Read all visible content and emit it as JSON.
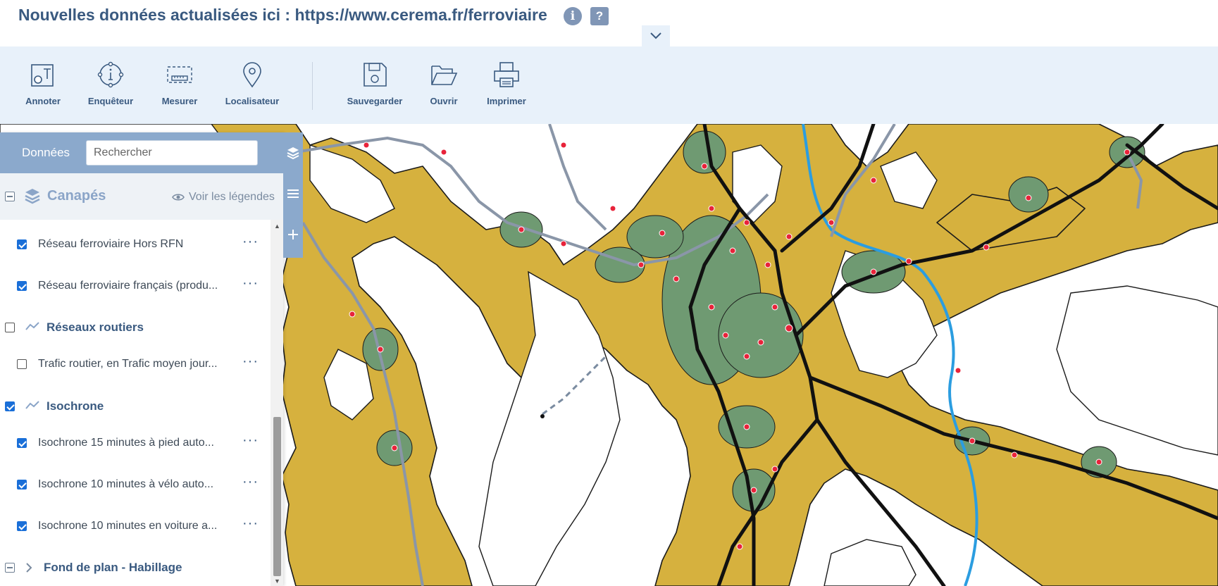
{
  "header": {
    "title": "Nouvelles données actualisées ici : https://www.cerema.fr/ferroviaire",
    "info_icon": "i",
    "help_icon": "?",
    "collapse_icon": "chevron-down-icon"
  },
  "toolbar": {
    "tools": [
      {
        "label": "Annoter",
        "icon": "annotate-icon"
      },
      {
        "label": "Enquêteur",
        "icon": "info-circle-icon"
      },
      {
        "label": "Mesurer",
        "icon": "ruler-icon"
      },
      {
        "label": "Localisateur",
        "icon": "map-pin-icon"
      },
      {
        "label": "Sauvegarder",
        "icon": "floppy-disk-icon"
      },
      {
        "label": "Ouvrir",
        "icon": "folder-open-icon"
      },
      {
        "label": "Imprimer",
        "icon": "printer-icon"
      }
    ]
  },
  "panel": {
    "tab_label": "Données",
    "search_placeholder": "Rechercher",
    "group_title": "Canapés",
    "legend_label": "Voir les légendes",
    "rows": [
      {
        "type": "layer",
        "label": "Réseau ferroviaire Hors RFN",
        "checked": true
      },
      {
        "type": "layer",
        "label": "Réseau ferroviaire français (produ...",
        "checked": true
      },
      {
        "type": "group",
        "label": "Réseaux routiers",
        "checked": false
      },
      {
        "type": "layer",
        "label": "Trafic routier, en Trafic moyen jour...",
        "checked": false
      },
      {
        "type": "group",
        "label": "Isochrone",
        "checked": true
      },
      {
        "type": "layer",
        "label": "Isochrone 15 minutes à pied auto...",
        "checked": true
      },
      {
        "type": "layer",
        "label": "Isochrone 10 minutes à vélo auto...",
        "checked": true
      },
      {
        "type": "layer",
        "label": "Isochrone 10 minutes en voiture a...",
        "checked": true
      },
      {
        "type": "folder",
        "label": "Fond de plan - Habillage",
        "checked": false
      }
    ],
    "more_label": "···"
  },
  "colors": {
    "isochrone_fill": "#d6b13e",
    "isochrone_walk": "#6f9a72",
    "rail_main": "#111111",
    "rail_other": "#8a96a8",
    "river": "#2b9de0",
    "station": "#e8233a",
    "accent": "#3a5a80"
  }
}
